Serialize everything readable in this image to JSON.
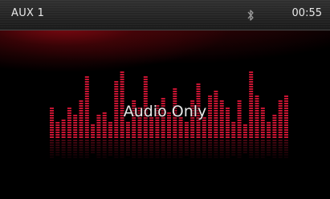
{
  "status_bar": {
    "source_label": "AUX 1",
    "clock": "00:55",
    "bluetooth_icon": "bluetooth-icon"
  },
  "main": {
    "message": "Audio Only"
  },
  "colors": {
    "accent": "#b0102a",
    "segment": "#c81432",
    "text": "#e6e6e6"
  },
  "equalizer": {
    "levels": [
      0.45,
      0.25,
      0.28,
      0.45,
      0.35,
      0.55,
      0.9,
      0.2,
      0.35,
      0.4,
      0.25,
      0.85,
      1.0,
      0.25,
      0.55,
      0.45,
      0.9,
      0.3,
      0.5,
      0.6,
      0.4,
      0.75,
      0.3,
      0.25,
      0.55,
      0.8,
      0.3,
      0.65,
      0.7,
      0.55,
      0.45,
      0.25,
      0.55,
      0.2,
      1.0,
      0.65,
      0.45,
      0.25,
      0.35,
      0.55,
      0.65
    ]
  }
}
